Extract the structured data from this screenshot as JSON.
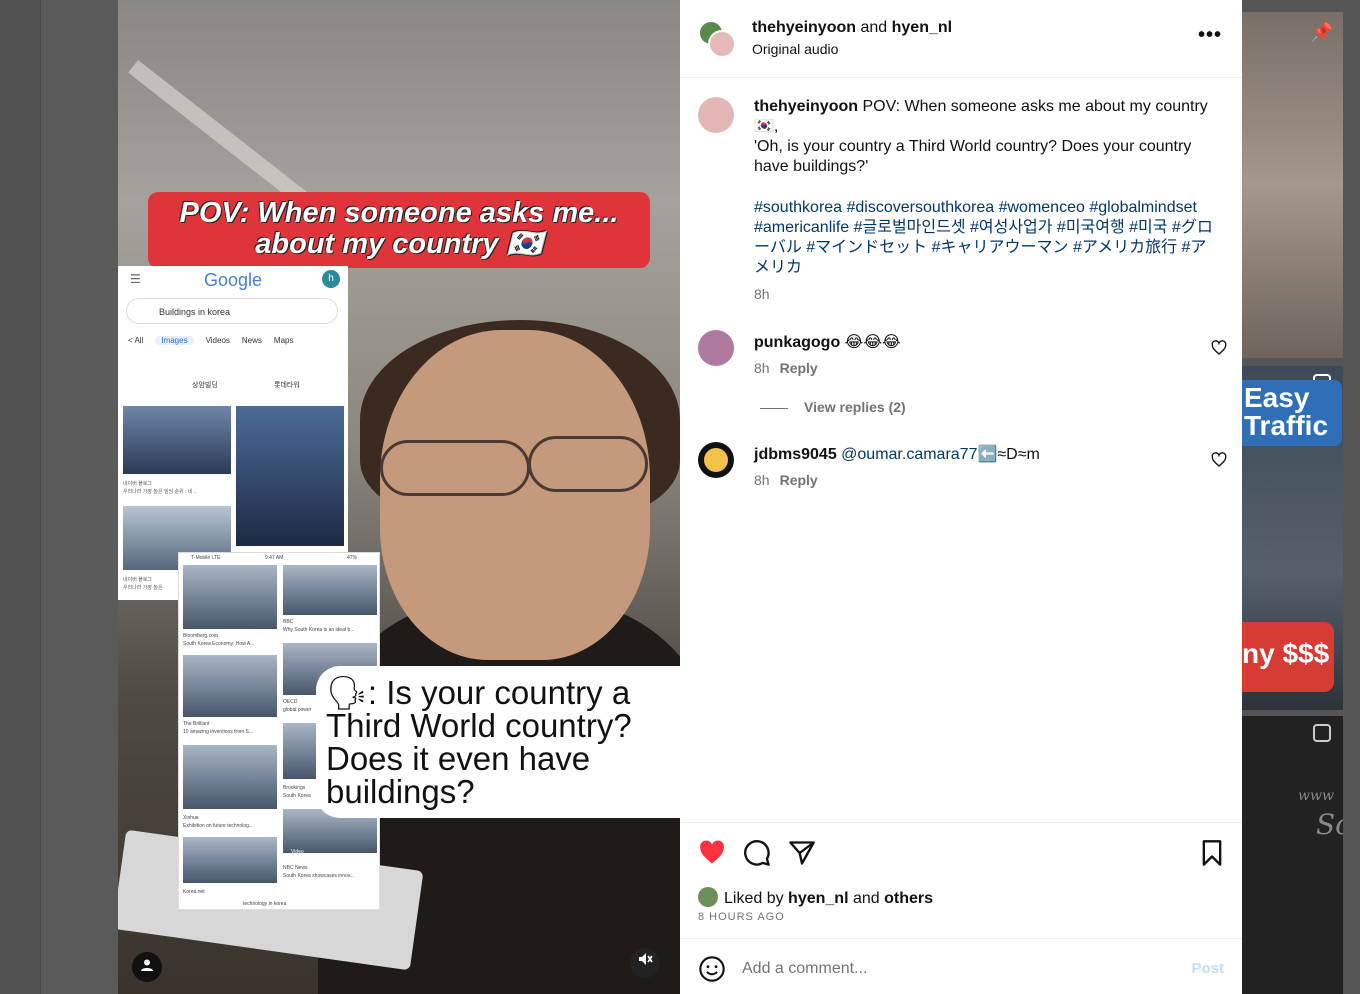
{
  "header": {
    "user1": "thehyeinyoon",
    "and": "and",
    "user2": "hyen_nl",
    "audio": "Original audio"
  },
  "video": {
    "pov_line1": "POV: When someone asks me...",
    "pov_line2": "about my country 🇰🇷",
    "speech": "🗣: Is your country a Third World country? Does it even have buildings?",
    "google": {
      "logo": "Google",
      "avatar": "h",
      "search": "Buildings in korea",
      "tabs": [
        "< All",
        "Images",
        "Videos",
        "News",
        "Maps"
      ],
      "chips": [
        "상암빌딩",
        "롯데타워"
      ],
      "captions": [
        "네이버 블로그",
        "우리나라 가장 높은 빌딩 순위 : 네 ..",
        "네이버 블로그",
        "우리나라 가장 높은"
      ]
    },
    "phone": {
      "status_left": "T-Mobile  LTE",
      "status_time": "9:47 AM",
      "status_right": "47%",
      "captions": [
        "Bloomberg.com",
        "South Korea Economy: How A...",
        "BBC",
        "Why South Korea is an ideal b...",
        "OECD",
        "global power",
        "The Brilliant",
        "10 amazing inventions from S...",
        "Brookings",
        "South Korea",
        "Xinhua",
        "Exhibition on future technolog...",
        "Video",
        "NBC News",
        "South Korea showcases innov...",
        "Korea.net",
        "technology in korea"
      ]
    }
  },
  "caption": {
    "username": "thehyeinyoon",
    "text_line1": " POV: When someone asks me about my country 🇰🇷,",
    "text_line2": "'Oh, is your country a Third World country? Does your country have buildings?'",
    "hashtags": "#southkorea #discoversouthkorea #womenceo #globalmindset #americanlife #글로벌마인드셋 #여성사업가 #미국여행 #미국 #グローバル #マインドセット #キャリアウーマン #アメリカ旅行 #アメリカ",
    "time": "8h"
  },
  "comments": [
    {
      "username": "punkagogo",
      "text": " 😂😂😂",
      "time": "8h",
      "reply": "Reply",
      "view_replies": "View replies (2)"
    },
    {
      "username": "jdbms9045",
      "mention": " @oumar.camara77",
      "text": "⬅️≈D≈m",
      "time": "8h",
      "reply": "Reply"
    }
  ],
  "likes": {
    "prefix": "Liked by ",
    "user": "hyen_nl",
    "middle": " and ",
    "others": "others",
    "ago": "8 HOURS AGO"
  },
  "comment_input": {
    "placeholder": "Add a comment...",
    "post": "Post"
  },
  "thumbs": {
    "easy": "Easy",
    "traffic": "Traffic",
    "money": "ny $$$",
    "chalk1": "www",
    "chalk2": "Sc"
  },
  "colors": {
    "like_red": "#ff3040",
    "link_blue": "#00376b",
    "banner_red": "#e0343b"
  }
}
